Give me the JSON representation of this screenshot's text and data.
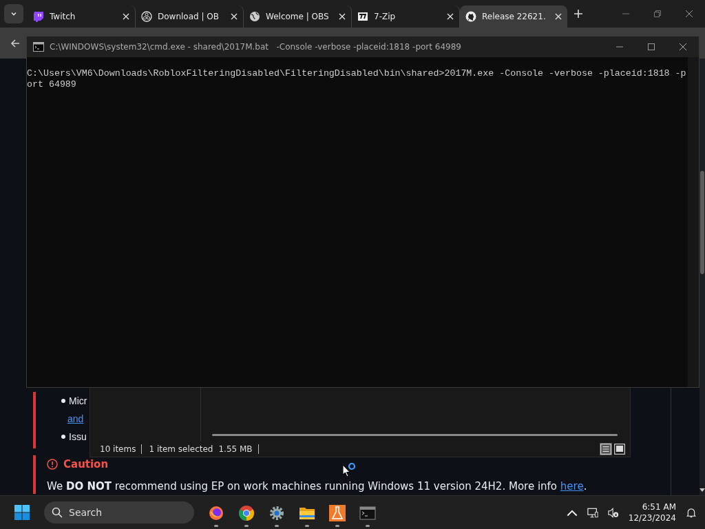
{
  "browser": {
    "tabs": [
      {
        "label": "Twitch",
        "kind": "twitch",
        "selected": false
      },
      {
        "label": "Download | OB",
        "kind": "obs",
        "selected": false
      },
      {
        "label": "Welcome | OBS",
        "kind": "web",
        "selected": false
      },
      {
        "label": "7-Zip",
        "kind": "archiver",
        "selected": false
      },
      {
        "label": "Release 22621.",
        "kind": "github",
        "selected": true
      }
    ]
  },
  "page": {
    "list": [
      {
        "kind": "bullet",
        "text": "Micr"
      },
      {
        "kind": "link",
        "text": "and"
      },
      {
        "kind": "bullet",
        "text": "Issu"
      }
    ],
    "caution": {
      "title": "Caution",
      "text": "We **DO NOT** recommend using EP on work machines running Windows 11 version 24H2. More info ",
      "link": "here",
      "after": "."
    }
  },
  "console": {
    "title": "C:\\WINDOWS\\system32\\cmd.exe - shared\\2017M.bat   -Console -verbose -placeid:1818 -port 64989",
    "lines": [
      "C:\\Users\\VM6\\Downloads\\RobloxFilteringDisabled\\FilteringDisabled\\bin\\shared>2017M.exe -Console -verbose -placeid:1818 -p",
      "ort 64989"
    ]
  },
  "explorer": {
    "status": [
      "10 items",
      "1 item selected",
      "1.55 MB"
    ],
    "views": [
      {
        "kind": "details",
        "selected": true
      },
      {
        "kind": "preview",
        "selected": false
      }
    ]
  },
  "taskbar": {
    "search": {
      "placeholder": "Search"
    },
    "apps": [
      {
        "kind": "firefox"
      },
      {
        "kind": "chrome"
      },
      {
        "kind": "settings"
      },
      {
        "kind": "folder"
      },
      {
        "kind": "flask"
      },
      {
        "kind": "terminal"
      }
    ],
    "time": "6:51 AM",
    "date": "12/23/2024"
  }
}
